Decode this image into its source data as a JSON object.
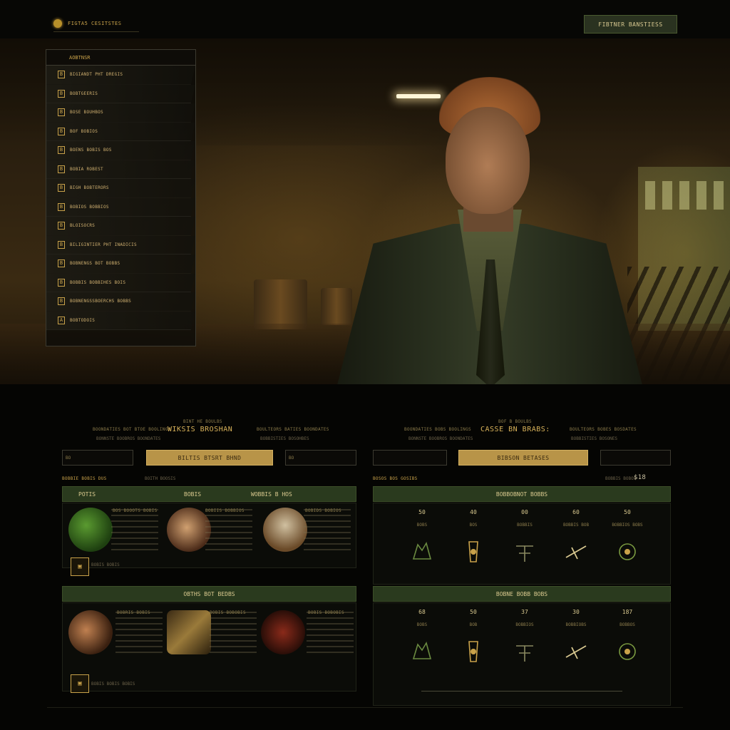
{
  "topbar": {
    "logo_text": "FIGTA5 CESITSTES",
    "button_label": "FIBTNER BANSTIESS"
  },
  "side_menu": {
    "title": "AOBTNSR",
    "items": [
      {
        "icon": "B",
        "label": "BIGIANDT PHT DREGIS"
      },
      {
        "icon": "B",
        "label": "BOBTGEERIS"
      },
      {
        "icon": "B",
        "label": "BOSE BOUHBOS"
      },
      {
        "icon": "B",
        "label": "BOF BOBIOS"
      },
      {
        "icon": "B",
        "label": "BOENS BOBIS BOS"
      },
      {
        "icon": "B",
        "label": "BOBIA ROBEST"
      },
      {
        "icon": "B",
        "label": "BIGH BOBTERORS"
      },
      {
        "icon": "B",
        "label": "BOBIOS BOBBIOS"
      },
      {
        "icon": "B",
        "label": "BLOISOCRS"
      },
      {
        "icon": "B",
        "label": "BILIGINTIER PHT INADICIS"
      },
      {
        "icon": "B",
        "label": "BOBNENGS BOT BOBBS"
      },
      {
        "icon": "B",
        "label": "BOBBIS BOBBIHES BOIS"
      },
      {
        "icon": "B",
        "label": "BOBNENGSSBOERCHS BOBBS"
      },
      {
        "icon": "A",
        "label": "BOBTODOIS"
      }
    ]
  },
  "left_panel": {
    "kicker": "BINT HE BOULBS",
    "subline_left": "BOONDATIES BOT BTOE BOOLINGS",
    "title": "WIKSIS BROSHAN",
    "subline_right": "BOULTEORS BATIES BOONDATES",
    "sub_left2": "BONNSTE BOOBROS BOONDATES",
    "sub_right2": "BOBBISTIES BOSOHBES",
    "field1": "BO",
    "cta": "BILTIS BTSRT BHND",
    "field2": "BO",
    "section_label": "BOBBIE BOBIS DUS",
    "section_meta": "BOITH BOOSIS",
    "tabs": [
      "POTIS",
      "BOBIS",
      "WOBBIS B HOS"
    ],
    "cards_top": [
      {
        "text": [
          "BOS BOOOTS BOBIS",
          "BOBIS BOBOTS BOBIS",
          "BOBIOS BOBIS",
          "BOBIS BOOBTS BOBIS",
          "BOBIS BOBIS"
        ],
        "caption": "BOBIS BOBIS"
      },
      {
        "text": [
          "BOBIIS BOBBIOS",
          "BOBNIS BOBIOS",
          "BOBIS BOBIS BOBS",
          "BOBIS BOBIS",
          "BOBIS BOBBIS"
        ]
      },
      {
        "text": [
          "BOBIDS BOBIOS",
          "BOBIS BOBOBIS",
          "BOBIS BOBBIS",
          "BOBIS BOBIS BOB",
          "BOBIS BOBIS"
        ]
      }
    ],
    "section2_title": "OBTHS BOT BEDBS",
    "cards_bottom": [
      {
        "text": [
          "BOBRIS BOBIS",
          "BOBIS BOBOBIS",
          "BOBIS BOBIS",
          "BOBIS BOBIS BOBS",
          "BOBIS BOBIS"
        ],
        "caption": "BOBIS BOBIS BOBIS"
      },
      {
        "text": [
          "BOBIS BOBOBIS",
          "BOBIS BOBIS",
          "BOBIS BOBIS BOB",
          "BOBIS BOBIS",
          "BOBIS BOBIS"
        ]
      },
      {
        "text": [
          "BOBIS BOBOBIS",
          "BOBIS BOBIS",
          "BOBIS BOBIS BOB",
          "BOBIS BOBIS",
          "BOBIS BOBIS"
        ]
      }
    ]
  },
  "right_panel": {
    "kicker": "BOF B BOULBS",
    "subline_left": "BOONDATIES BOBS BOOLINGS",
    "title": "CASSE BN BRABS:",
    "subline_right": "BOULTEORS BOBES BOSDATES",
    "sub_left2": "BONNSTE BOOBROS BOONDATES",
    "sub_right2": "BOBBISTIES BOSONES",
    "field1": "",
    "cta": "BIBSON BETASES",
    "field2": "",
    "section_label": "BOSOS BOS GOSIBS",
    "count_prefix": "BOBBIS BOBOS",
    "count": "$18",
    "group1_title": "BOBBOBNOT BOBBS",
    "group1_stats": [
      {
        "num": "50",
        "label": "BOBS"
      },
      {
        "num": "40",
        "label": "BOS"
      },
      {
        "num": "00",
        "label": "BOBBIS"
      },
      {
        "num": "60",
        "label": "BOBBIS BOB"
      },
      {
        "num": "50",
        "label": "BOBBIOS BOBS"
      }
    ],
    "group2_title": "BOBNE BOBB BOBS",
    "group2_stats": [
      {
        "num": "68",
        "label": "BOBS"
      },
      {
        "num": "50",
        "label": "BOB"
      },
      {
        "num": "37",
        "label": "BOBBIOS"
      },
      {
        "num": "30",
        "label": "BOBBIOBS"
      },
      {
        "num": "187",
        "label": "BOBBOS"
      }
    ]
  }
}
